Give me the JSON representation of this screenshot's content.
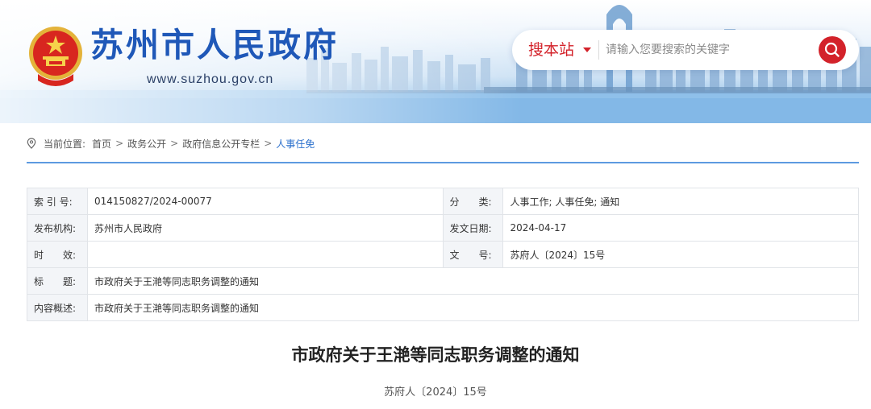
{
  "header": {
    "site_title": "苏州市人民政府",
    "site_url": "www.suzhou.gov.cn",
    "emblem_icon": "national-emblem-icon",
    "search": {
      "scope_label": "搜本站",
      "placeholder": "请输入您要搜索的关键字",
      "value": "",
      "button_icon": "search-icon"
    },
    "colors": {
      "brand_blue": "#1f58b8",
      "accent_red": "#d3222a"
    }
  },
  "breadcrumb": {
    "lead": "当前位置:",
    "items": [
      "首页",
      "政务公开",
      "政府信息公开专栏",
      "人事任免"
    ],
    "separator": ">"
  },
  "meta": {
    "index_no": {
      "label": "索 引 号:",
      "value": "014150827/2024-00077"
    },
    "category": {
      "label": "分　　类:",
      "value": "人事工作;  人事任免;  通知"
    },
    "publisher": {
      "label": "发布机构:",
      "value": "苏州市人民政府"
    },
    "issue_date": {
      "label": "发文日期:",
      "value": "2024-04-17"
    },
    "validity": {
      "label": "时　　效:",
      "value": ""
    },
    "doc_no": {
      "label": "文　　号:",
      "value": "苏府人〔2024〕15号"
    },
    "title": {
      "label": "标　　题:",
      "value": "市政府关于王滟等同志职务调整的通知"
    },
    "summary": {
      "label": "内容概述:",
      "value": "市政府关于王滟等同志职务调整的通知"
    }
  },
  "document": {
    "title": "市政府关于王滟等同志职务调整的通知",
    "number": "苏府人〔2024〕15号"
  }
}
